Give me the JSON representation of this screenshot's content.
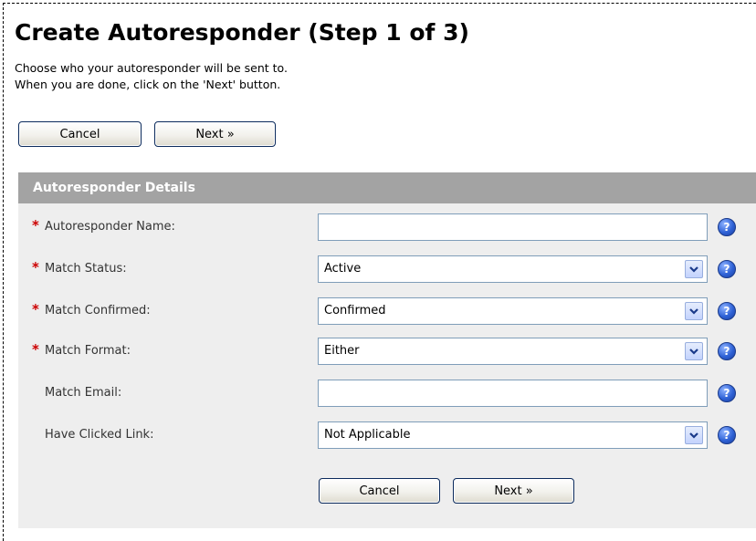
{
  "page": {
    "title": "Create Autoresponder (Step 1 of 3)",
    "intro_line1": "Choose who your autoresponder will be sent to.",
    "intro_line2": "When you are done, click on the 'Next' button."
  },
  "toolbar": {
    "cancel_label": "Cancel",
    "next_label": "Next »"
  },
  "section": {
    "title": "Autoresponder Details"
  },
  "fields": {
    "name": {
      "label": "Autoresponder Name:",
      "required": "*",
      "value": ""
    },
    "status": {
      "label": "Match Status:",
      "required": "*",
      "selected": "Active"
    },
    "confirmed": {
      "label": "Match Confirmed:",
      "required": "*",
      "selected": "Confirmed"
    },
    "format": {
      "label": "Match Format:",
      "required": "*",
      "selected": "Either"
    },
    "email": {
      "label": "Match Email:",
      "value": ""
    },
    "clicked": {
      "label": "Have Clicked Link:",
      "selected": "Not Applicable"
    }
  },
  "help": {
    "icon": "question-help-icon",
    "glyph": "?"
  },
  "footer": {
    "cancel_label": "Cancel",
    "next_label": "Next »"
  },
  "colors": {
    "section_header_bg": "#a3a3a3",
    "form_bg": "#eeeeee",
    "required_mark": "#cc0000",
    "help_icon": "#2f62d6"
  }
}
